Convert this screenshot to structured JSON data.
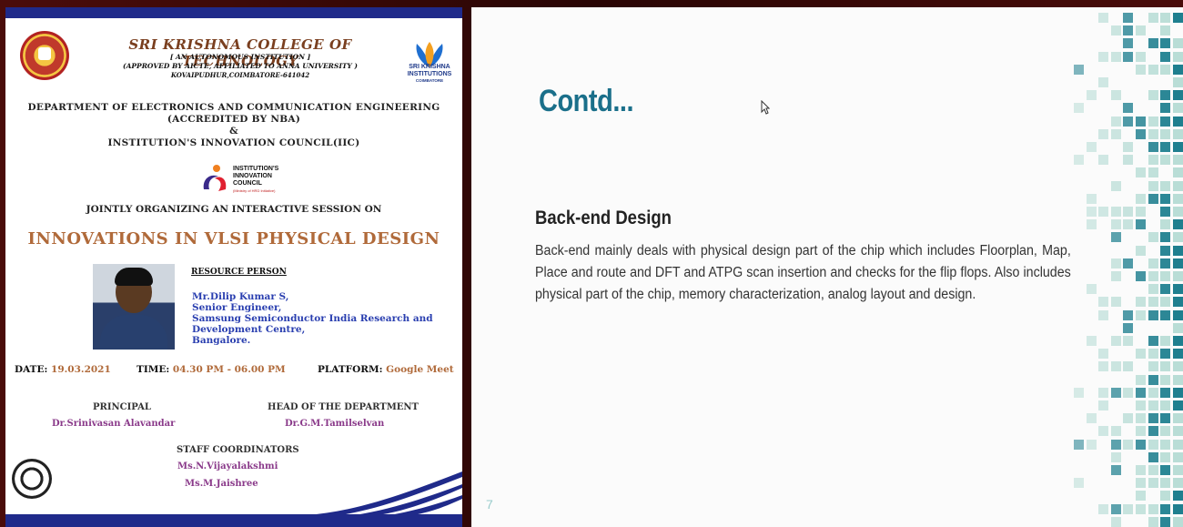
{
  "poster": {
    "college_name": "SRI KRISHNA COLLEGE OF TECHNOLOGY",
    "autonomous": "[ AN AUTONOMOUS INSTITUTION ]",
    "approval": "(APPROVED BY AICTE, AFFILIATED TO ANNA UNIVERSITY )",
    "address": "KOVAIPUDHUR,COIMBATORE-641042",
    "brand_line1": "SRI KRISHNA",
    "brand_line2": "INSTITUTIONS",
    "brand_line3": "COIMBATORE",
    "dept_line1": "DEPARTMENT OF ELECTRONICS AND COMMUNICATION ENGINEERING",
    "dept_line2": "(ACCREDITED BY NBA)",
    "dept_line3": "&",
    "dept_line4": "INSTITUTION'S INNOVATION COUNCIL(IIC)",
    "iic_line1": "INSTITUTION'S",
    "iic_line2": "INNOVATION",
    "iic_line3": "COUNCIL",
    "iic_line4": "(Ministry of HRD Initiative)",
    "jointly": "JOINTLY ORGANIZING AN INTERACTIVE SESSION ON",
    "event_title": "INNOVATIONS IN VLSI PHYSICAL DESIGN",
    "resource_label": "RESOURCE PERSON",
    "resource_lines": [
      "Mr.Dilip Kumar S,",
      "Senior Engineer,",
      "Samsung Semiconductor India Research and",
      "Development Centre,",
      "Bangalore."
    ],
    "date_key": "DATE:",
    "date_val": "19.03.2021",
    "time_key": "TIME:",
    "time_val": "04.30 PM - 06.00 PM",
    "platform_key": "PLATFORM:",
    "platform_val": "Google Meet",
    "principal_role": "PRINCIPAL",
    "principal_name": "Dr.Srinivasan Alavandar",
    "hod_role": "HEAD OF THE DEPARTMENT",
    "hod_name": "Dr.G.M.Tamilselvan",
    "staff_role": "STAFF COORDINATORS",
    "staff_names": [
      "Ms.N.Vijayalakshmi",
      "Ms.M.Jaishree"
    ]
  },
  "slide": {
    "title": "Contd...",
    "section_title": "Back-end Design",
    "paragraph": "Back-end mainly deals with physical design part of the chip which includes Floorplan, Map, Place and route and DFT and ATPG scan insertion and checks for the flip flops. Also includes physical  part of the chip, memory characterization, analog layout and design.",
    "page_number": "7"
  },
  "colors": {
    "poster_bar": "#1f2a8a",
    "event_title": "#b06a3a",
    "resource_name": "#2a3fb0",
    "slide_title": "#1a6f8a",
    "tile_dark": "#1f7f8f",
    "tile_light": "#b9ddd6"
  }
}
